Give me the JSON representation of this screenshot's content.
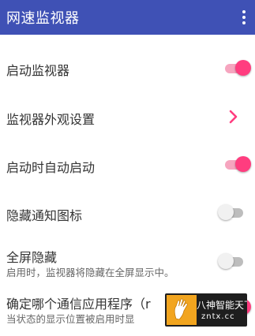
{
  "app_bar": {
    "title": "网速监视器",
    "icon": "more-vert-icon",
    "color": "#3F51B5"
  },
  "settings": {
    "start_monitor": {
      "label": "启动监视器",
      "switch_on": true
    },
    "appearance": {
      "label": "监视器外观设置",
      "icon": "chevron-right-icon"
    },
    "auto_start": {
      "label": "启动时自动启动",
      "switch_on": true
    },
    "hide_notification_icon": {
      "label": "隐藏通知图标",
      "switch_on": false
    },
    "fullscreen_hide": {
      "label": "全屏隐藏",
      "summary": "启用时，监视器将隐藏在全屏显示中。",
      "switch_on": false
    },
    "comm_apps": {
      "label": "确定哪个通信应用程序（r",
      "summary": "当状态的显示位置被启用时显",
      "switch_on": true
    }
  },
  "colors": {
    "accent": "#FF3D7F",
    "accent_track": "#F6A5BF"
  },
  "watermark": {
    "text_cn": "八神智能天下",
    "text_url": "zntx.cc"
  }
}
